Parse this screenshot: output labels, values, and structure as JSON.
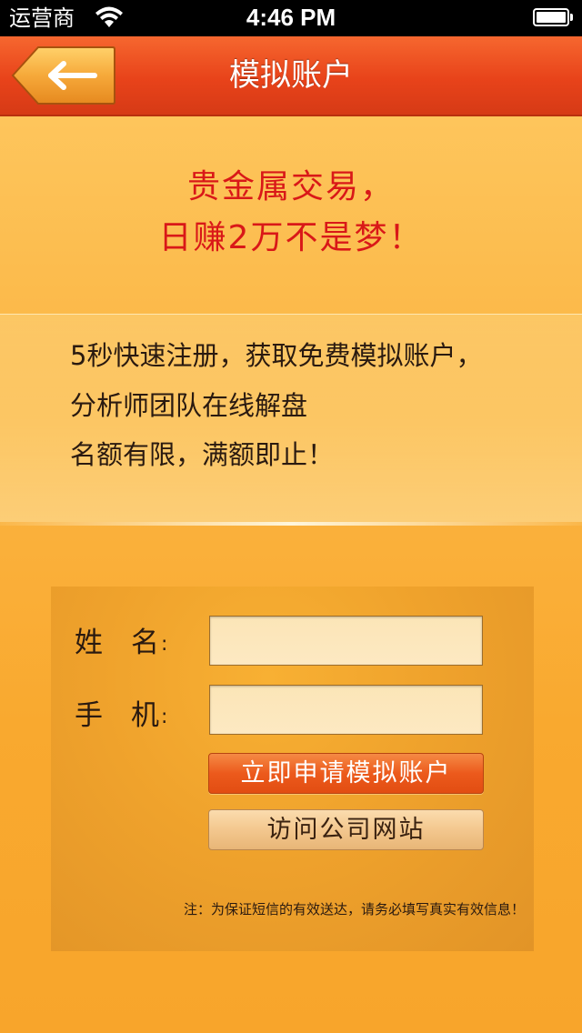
{
  "status_bar": {
    "carrier": "运营商",
    "time": "4:46 PM"
  },
  "nav": {
    "title": "模拟账户"
  },
  "headline": {
    "line1": "贵金属交易，",
    "line2": "日赚2万不是梦！"
  },
  "intro": {
    "line1": "5秒快速注册，获取免费模拟账户，",
    "line2": "分析师团队在线解盘",
    "line3": "名额有限，满额即止！"
  },
  "form": {
    "name_label": "姓　名",
    "name_colon": ":",
    "name_value": "",
    "phone_label": "手　机",
    "phone_colon": ":",
    "phone_value": "",
    "apply_button": "立即申请模拟账户",
    "site_button": "访问公司网站",
    "note": "注：为保证短信的有效送达，请务必填写真实有效信息！"
  },
  "colors": {
    "nav_bar": "#e8431a",
    "headline_red": "#d91818",
    "background": "#fbb746",
    "apply_button": "#ec5a1c"
  },
  "icons": {
    "back": "arrow-left-icon",
    "wifi": "wifi-icon",
    "battery": "battery-icon"
  }
}
